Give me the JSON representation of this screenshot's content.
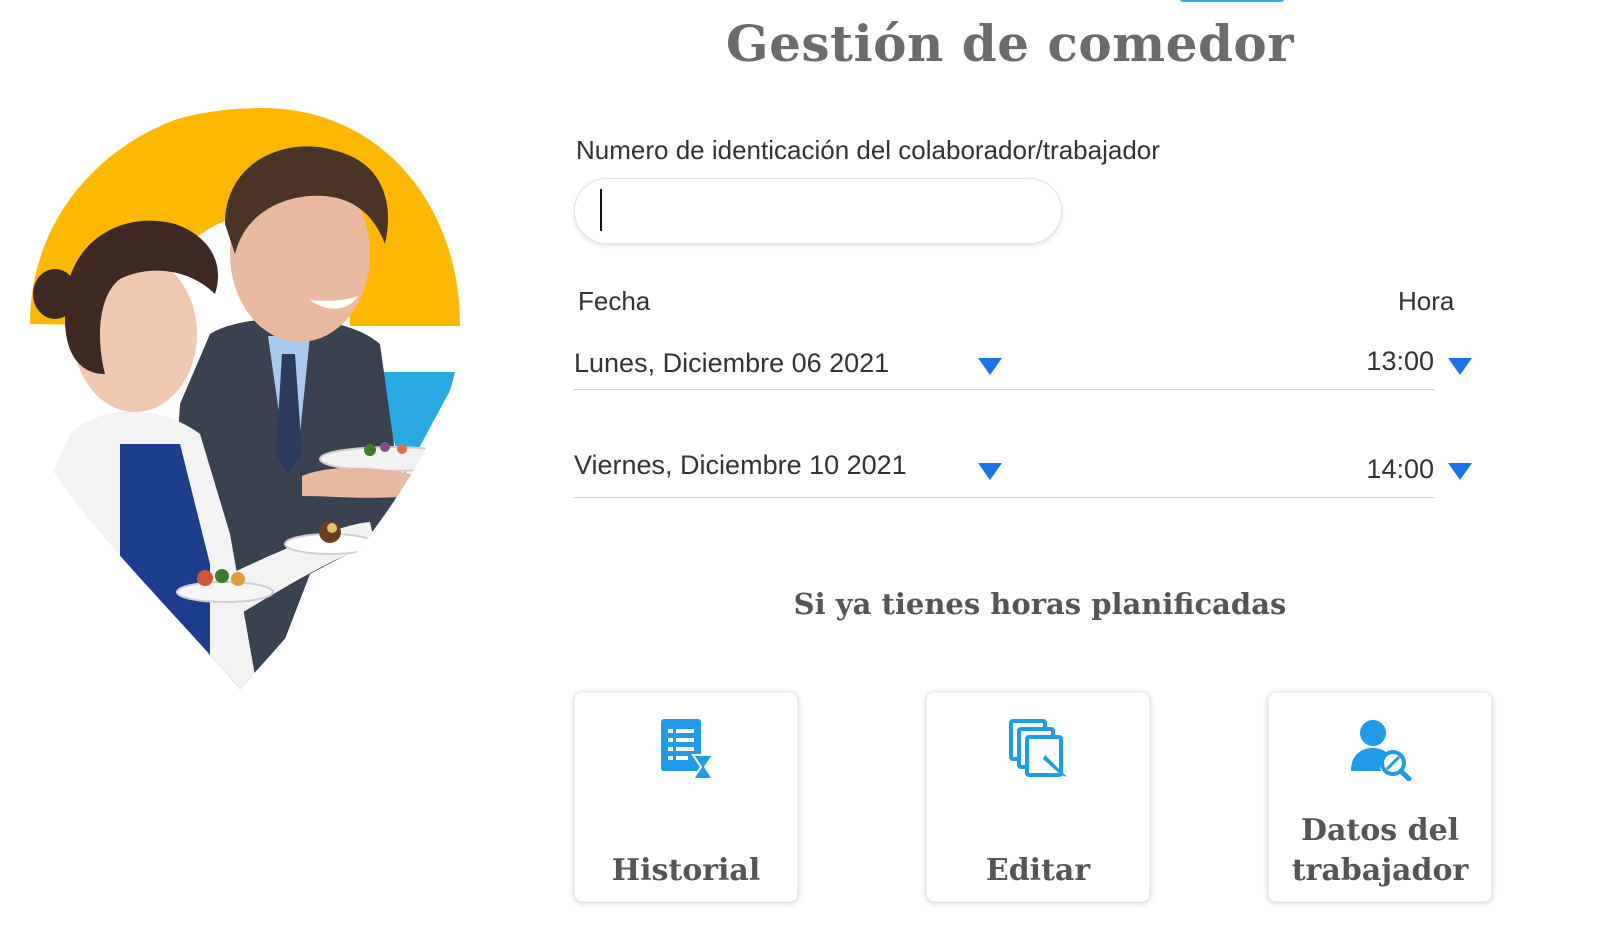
{
  "header": {
    "title": "Gestión de comedor"
  },
  "form": {
    "id_label": "Numero de identicación del colaborador/trabajador",
    "id_value": "",
    "date_label": "Fecha",
    "time_label": "Hora",
    "rows": [
      {
        "date": "Lunes, Diciembre 06 2021",
        "time": "13:00"
      },
      {
        "date": "Viernes, Diciembre 10 2021",
        "time": "14:00"
      }
    ]
  },
  "planned": {
    "heading": "Si ya tienes horas planificadas",
    "actions": [
      {
        "label": "Historial",
        "icon": "history-list-icon"
      },
      {
        "label": "Editar",
        "icon": "edit-pages-icon"
      },
      {
        "label": "Datos del trabajador",
        "icon": "user-search-icon"
      }
    ]
  },
  "colors": {
    "accent_blue": "#1a73e8",
    "icon_blue": "#1e9be9",
    "hero_yellow": "#ffb800",
    "hero_light_blue": "#29aae2"
  }
}
